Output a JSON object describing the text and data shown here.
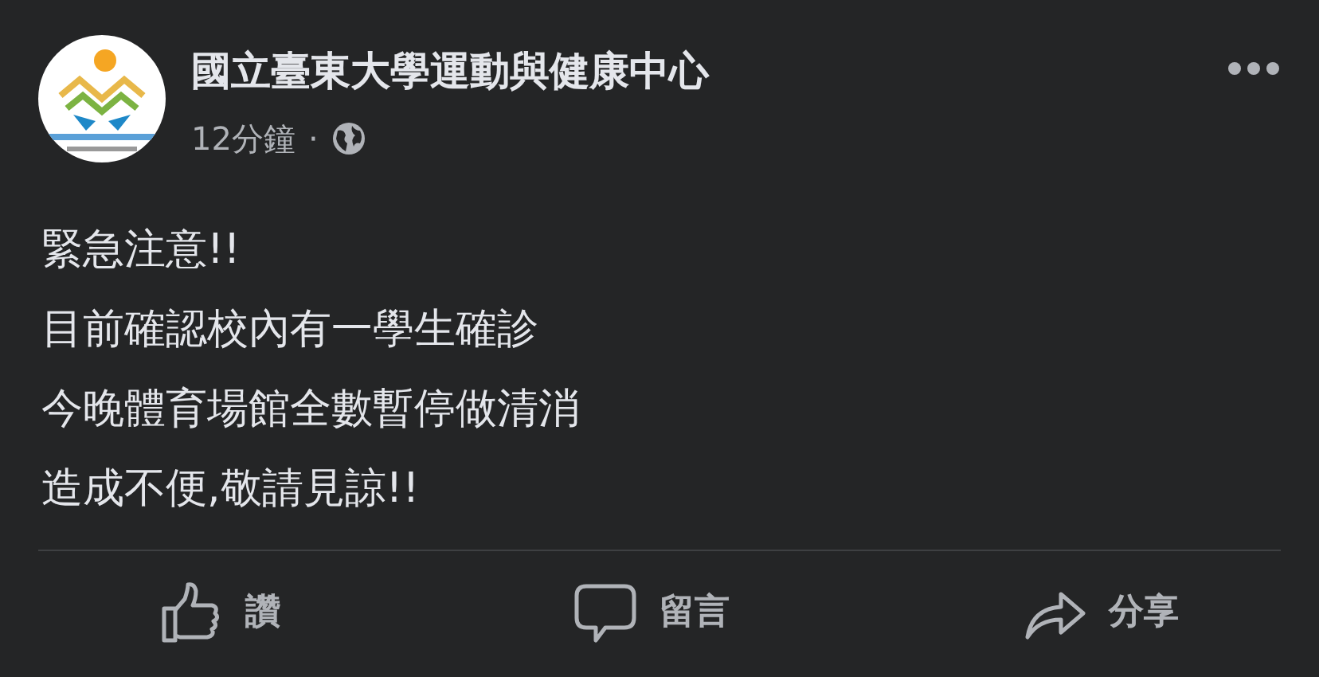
{
  "post": {
    "author": "國立臺東大學運動與健康中心",
    "time": "12分鐘",
    "separator": "·",
    "body": [
      "緊急注意!!",
      "目前確認校內有一學生確診",
      "今晚體育場館全數暫停做清消",
      "造成不便,敬請見諒!!"
    ]
  },
  "actions": [
    {
      "kind": "like",
      "label": "讚"
    },
    {
      "kind": "comment",
      "label": "留言"
    },
    {
      "kind": "share",
      "label": "分享"
    }
  ]
}
